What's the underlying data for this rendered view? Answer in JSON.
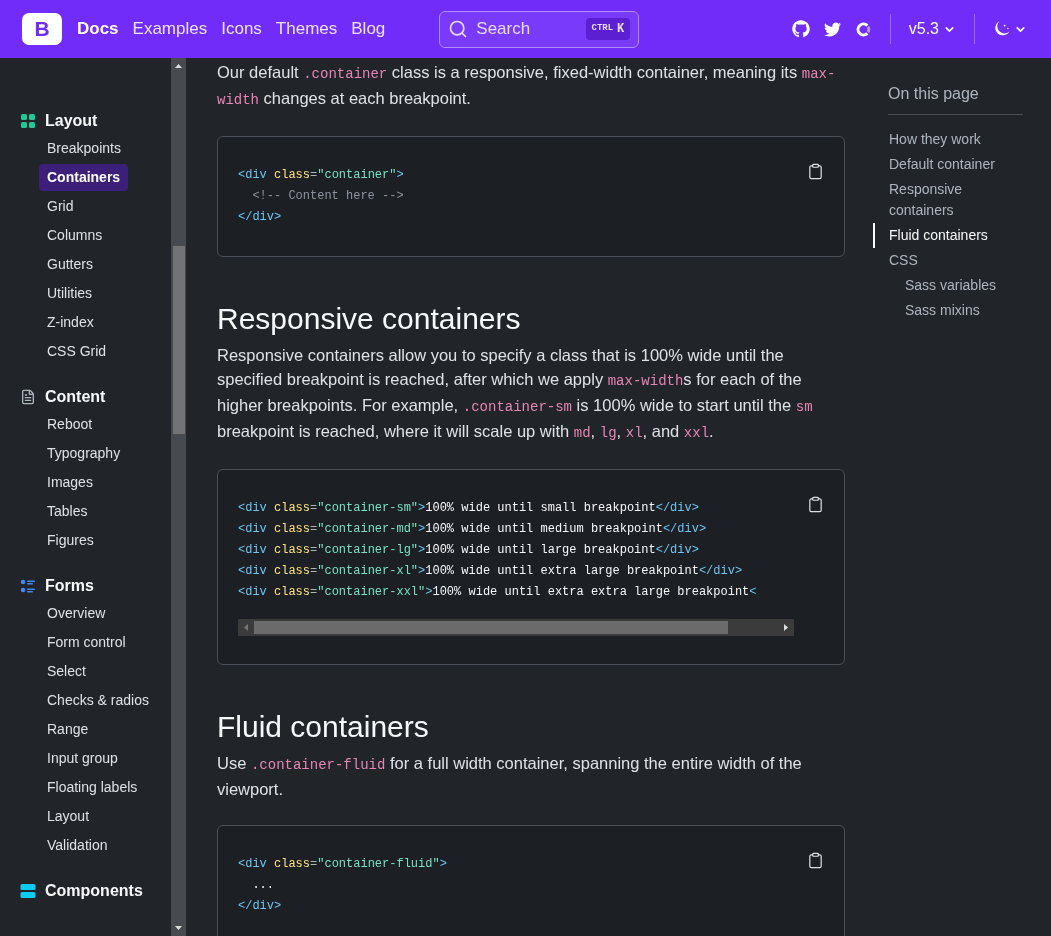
{
  "navbar": {
    "logo": "B",
    "links": [
      {
        "label": "Docs",
        "selected": true
      },
      {
        "label": "Examples",
        "selected": false
      },
      {
        "label": "Icons",
        "selected": false
      },
      {
        "label": "Themes",
        "selected": false
      },
      {
        "label": "Blog",
        "selected": false
      }
    ],
    "search": {
      "placeholder": "Search",
      "shortcut": [
        "CTRL",
        "K"
      ]
    },
    "version": "v5.3"
  },
  "sidebar": {
    "groups": [
      {
        "title": "Layout",
        "color": "#20c997",
        "items": [
          {
            "label": "Breakpoints",
            "selected": false
          },
          {
            "label": "Containers",
            "selected": true
          },
          {
            "label": "Grid",
            "selected": false
          },
          {
            "label": "Columns",
            "selected": false
          },
          {
            "label": "Gutters",
            "selected": false
          },
          {
            "label": "Utilities",
            "selected": false
          },
          {
            "label": "Z-index",
            "selected": false
          },
          {
            "label": "CSS Grid",
            "selected": false
          }
        ]
      },
      {
        "title": "Content",
        "color": "#adb5bd",
        "items": [
          {
            "label": "Reboot",
            "selected": false
          },
          {
            "label": "Typography",
            "selected": false
          },
          {
            "label": "Images",
            "selected": false
          },
          {
            "label": "Tables",
            "selected": false
          },
          {
            "label": "Figures",
            "selected": false
          }
        ]
      },
      {
        "title": "Forms",
        "color": "#3d8bfd",
        "items": [
          {
            "label": "Overview",
            "selected": false
          },
          {
            "label": "Form control",
            "selected": false
          },
          {
            "label": "Select",
            "selected": false
          },
          {
            "label": "Checks & radios",
            "selected": false
          },
          {
            "label": "Range",
            "selected": false
          },
          {
            "label": "Input group",
            "selected": false
          },
          {
            "label": "Floating labels",
            "selected": false
          },
          {
            "label": "Layout",
            "selected": false
          },
          {
            "label": "Validation",
            "selected": false
          }
        ]
      },
      {
        "title": "Components",
        "color": "#0dcaf0"
      }
    ]
  },
  "sections": [
    {
      "paragraph": [
        {
          "kind": "text",
          "t": "Our default "
        },
        {
          "kind": "code",
          "t": ".container"
        },
        {
          "kind": "text",
          "t": " class is a responsive, fixed-width container, meaning its "
        },
        {
          "kind": "code",
          "t": "max-width"
        },
        {
          "kind": "text",
          "t": " changes at each breakpoint."
        }
      ],
      "code": [
        [
          {
            "kind": "tag",
            "t": "<div"
          },
          {
            "kind": "attr",
            "t": " class"
          },
          {
            "kind": "punct",
            "t": "="
          },
          {
            "kind": "str",
            "t": "\"container\""
          },
          {
            "kind": "tag",
            "t": ">"
          }
        ],
        [
          {
            "kind": "comment",
            "t": "  <!-- Content here -->"
          }
        ],
        [
          {
            "kind": "tag",
            "t": "</div>"
          }
        ]
      ],
      "scrollbar": false
    },
    {
      "heading": "Responsive containers",
      "paragraph": [
        {
          "kind": "text",
          "t": "Responsive containers allow you to specify a class that is 100% wide until the specified breakpoint is reached, after which we apply "
        },
        {
          "kind": "code",
          "t": "max-width"
        },
        {
          "kind": "text",
          "t": "s for each of the higher breakpoints. For example, "
        },
        {
          "kind": "code",
          "t": ".container-sm"
        },
        {
          "kind": "text",
          "t": " is 100% wide to start until the "
        },
        {
          "kind": "code",
          "t": "sm"
        },
        {
          "kind": "text",
          "t": " breakpoint is reached, where it will scale up with "
        },
        {
          "kind": "code",
          "t": "md"
        },
        {
          "kind": "text",
          "t": ", "
        },
        {
          "kind": "code",
          "t": "lg"
        },
        {
          "kind": "text",
          "t": ", "
        },
        {
          "kind": "code",
          "t": "xl"
        },
        {
          "kind": "text",
          "t": ", and "
        },
        {
          "kind": "code",
          "t": "xxl"
        },
        {
          "kind": "text",
          "t": "."
        }
      ],
      "code": [
        [
          {
            "kind": "tag",
            "t": "<div"
          },
          {
            "kind": "attr",
            "t": " class"
          },
          {
            "kind": "punct",
            "t": "="
          },
          {
            "kind": "str",
            "t": "\"container-sm\""
          },
          {
            "kind": "tag",
            "t": ">"
          },
          {
            "kind": "text",
            "t": "100% wide until small breakpoint"
          },
          {
            "kind": "tag",
            "t": "</div>"
          }
        ],
        [
          {
            "kind": "tag",
            "t": "<div"
          },
          {
            "kind": "attr",
            "t": " class"
          },
          {
            "kind": "punct",
            "t": "="
          },
          {
            "kind": "str",
            "t": "\"container-md\""
          },
          {
            "kind": "tag",
            "t": ">"
          },
          {
            "kind": "text",
            "t": "100% wide until medium breakpoint"
          },
          {
            "kind": "tag",
            "t": "</div>"
          }
        ],
        [
          {
            "kind": "tag",
            "t": "<div"
          },
          {
            "kind": "attr",
            "t": " class"
          },
          {
            "kind": "punct",
            "t": "="
          },
          {
            "kind": "str",
            "t": "\"container-lg\""
          },
          {
            "kind": "tag",
            "t": ">"
          },
          {
            "kind": "text",
            "t": "100% wide until large breakpoint"
          },
          {
            "kind": "tag",
            "t": "</div>"
          }
        ],
        [
          {
            "kind": "tag",
            "t": "<div"
          },
          {
            "kind": "attr",
            "t": " class"
          },
          {
            "kind": "punct",
            "t": "="
          },
          {
            "kind": "str",
            "t": "\"container-xl\""
          },
          {
            "kind": "tag",
            "t": ">"
          },
          {
            "kind": "text",
            "t": "100% wide until extra large breakpoint"
          },
          {
            "kind": "tag",
            "t": "</div>"
          }
        ],
        [
          {
            "kind": "tag",
            "t": "<div"
          },
          {
            "kind": "attr",
            "t": " class"
          },
          {
            "kind": "punct",
            "t": "="
          },
          {
            "kind": "str",
            "t": "\"container-xxl\""
          },
          {
            "kind": "tag",
            "t": ">"
          },
          {
            "kind": "text",
            "t": "100% wide until extra extra large breakpoint"
          },
          {
            "kind": "tag",
            "t": "<"
          }
        ]
      ],
      "scrollbar": true
    },
    {
      "heading": "Fluid containers",
      "paragraph": [
        {
          "kind": "text",
          "t": "Use "
        },
        {
          "kind": "code",
          "t": ".container-fluid"
        },
        {
          "kind": "text",
          "t": " for a full width container, spanning the entire width of the viewport."
        }
      ],
      "code": [
        [
          {
            "kind": "tag",
            "t": "<div"
          },
          {
            "kind": "attr",
            "t": " class"
          },
          {
            "kind": "punct",
            "t": "="
          },
          {
            "kind": "str",
            "t": "\"container-fluid\""
          },
          {
            "kind": "tag",
            "t": ">"
          }
        ],
        [
          {
            "kind": "text",
            "t": "  ..."
          }
        ],
        [
          {
            "kind": "tag",
            "t": "</div>"
          }
        ]
      ],
      "scrollbar": false
    }
  ],
  "toc": {
    "title": "On this page",
    "items": [
      {
        "label": "How they work",
        "selected": false
      },
      {
        "label": "Default container",
        "selected": false
      },
      {
        "label": "Responsive containers",
        "selected": false
      },
      {
        "label": "Fluid containers",
        "selected": true
      },
      {
        "label": "CSS",
        "selected": false,
        "children": [
          {
            "label": "Sass variables",
            "selected": false
          },
          {
            "label": "Sass mixins",
            "selected": false
          }
        ]
      }
    ]
  }
}
